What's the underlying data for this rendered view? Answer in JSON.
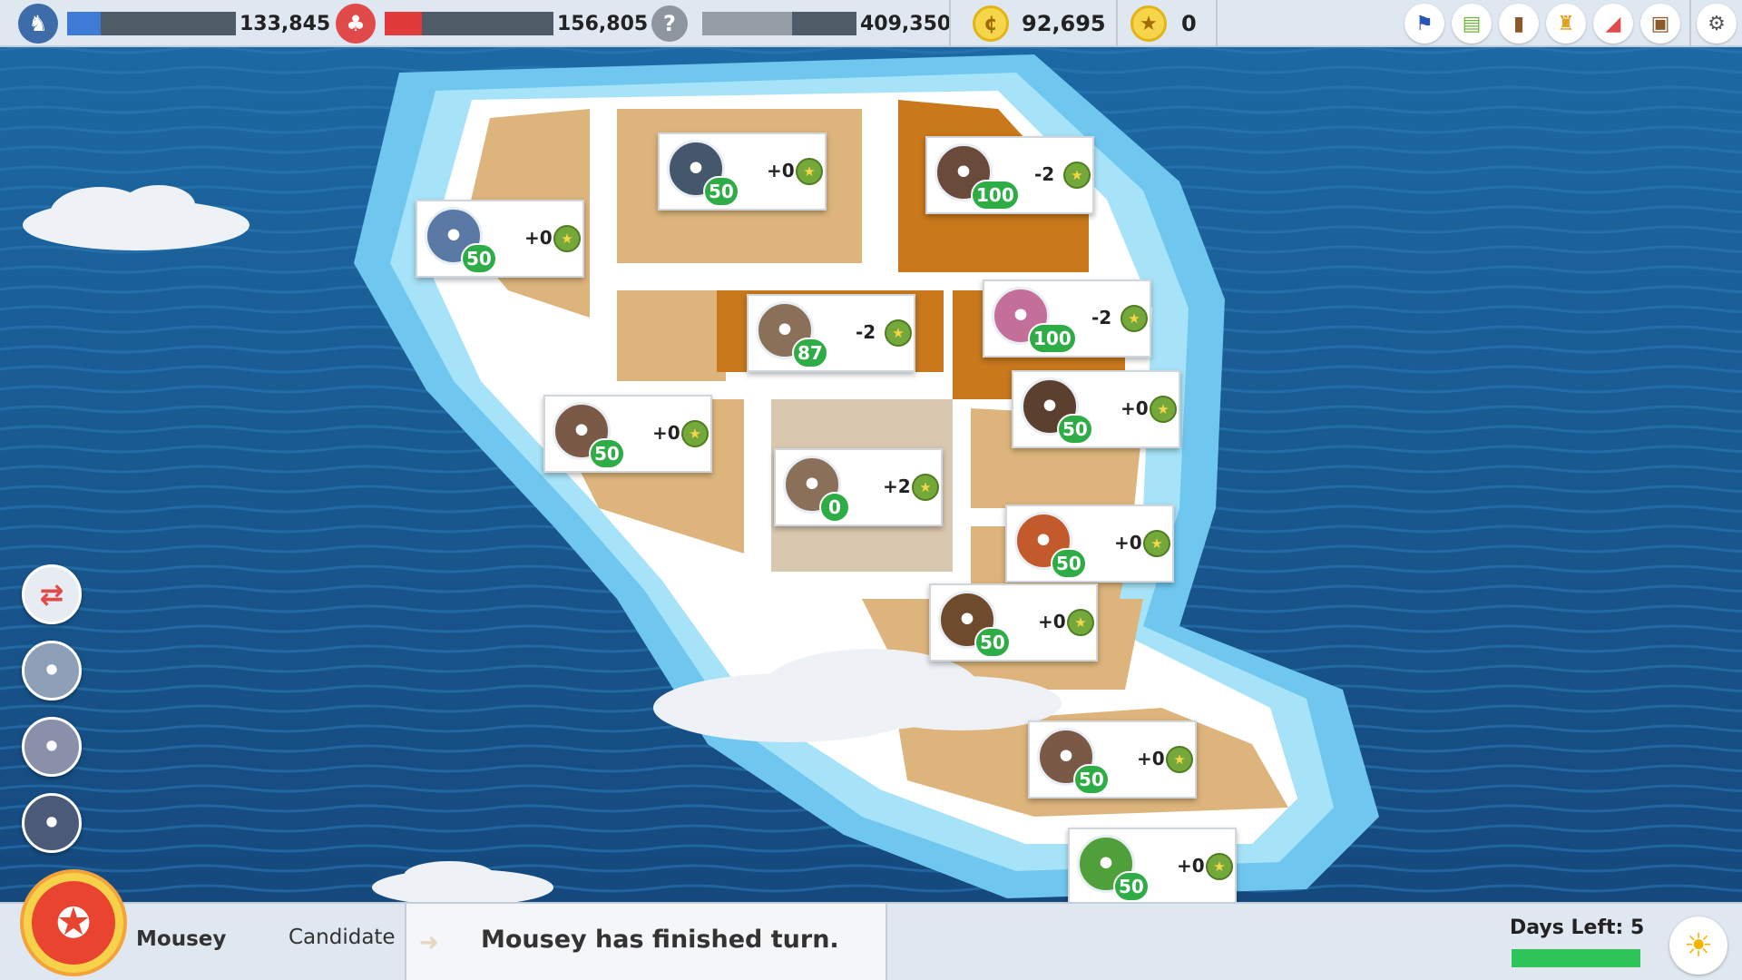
{
  "top": {
    "player1": {
      "name": "player1-score",
      "value": "133,845",
      "color": "#3d7bd6",
      "progress": 0.2
    },
    "player2": {
      "name": "player2-score",
      "value": "156,805",
      "color": "#e03a3a",
      "progress": 0.22
    },
    "unknown": {
      "symbol": "?",
      "value": "409,350",
      "color": "#959da7",
      "progress": 0.58
    },
    "coins": "92,695",
    "stars": "0",
    "icons": [
      "flag-icon",
      "cash-icon",
      "jar-icon",
      "trophy-icon",
      "megaphone-icon",
      "chest-icon",
      "gear-icon"
    ]
  },
  "map": {
    "districts": [
      {
        "delta": "+0",
        "level": "50",
        "portrait": "walrus-officer",
        "color": "#5b79a5"
      },
      {
        "delta": "+0",
        "level": "50",
        "portrait": "bull-cop",
        "color": "#45576d"
      },
      {
        "delta": "-2",
        "level": "100",
        "portrait": "mole-miner",
        "color": "#6a4a3a"
      },
      {
        "delta": "-2",
        "level": "87",
        "portrait": "owl-worker",
        "color": "#8a7058"
      },
      {
        "delta": "-2",
        "level": "100",
        "portrait": "cat-pink-hat",
        "color": "#c46f9a"
      },
      {
        "delta": "+0",
        "level": "50",
        "portrait": "anteater-worker",
        "color": "#7a5a46"
      },
      {
        "delta": "+0",
        "level": "50",
        "portrait": "mole-miner",
        "color": "#5b3f2f"
      },
      {
        "delta": "+2",
        "level": "0",
        "portrait": "owl-worker",
        "color": "#8a7058"
      },
      {
        "delta": "+0",
        "level": "50",
        "portrait": "fox-astronaut",
        "color": "#c35a2c"
      },
      {
        "delta": "+0",
        "level": "50",
        "portrait": "beaver-sailor",
        "color": "#6f4b2e"
      },
      {
        "delta": "+0",
        "level": "50",
        "portrait": "anteater-worker",
        "color": "#7a5a46"
      },
      {
        "delta": "+0",
        "level": "50",
        "portrait": "crocodile-bandana",
        "color": "#4fa03a"
      }
    ]
  },
  "side_icons": [
    "swap-icon",
    "hippo-icon",
    "rhino-icon",
    "spy-icon"
  ],
  "bottom": {
    "name": "Mousey",
    "role": "Candidate",
    "message": "Mousey has finished turn.",
    "days_label": "Days Left: 5",
    "days_progress": 1.0
  }
}
